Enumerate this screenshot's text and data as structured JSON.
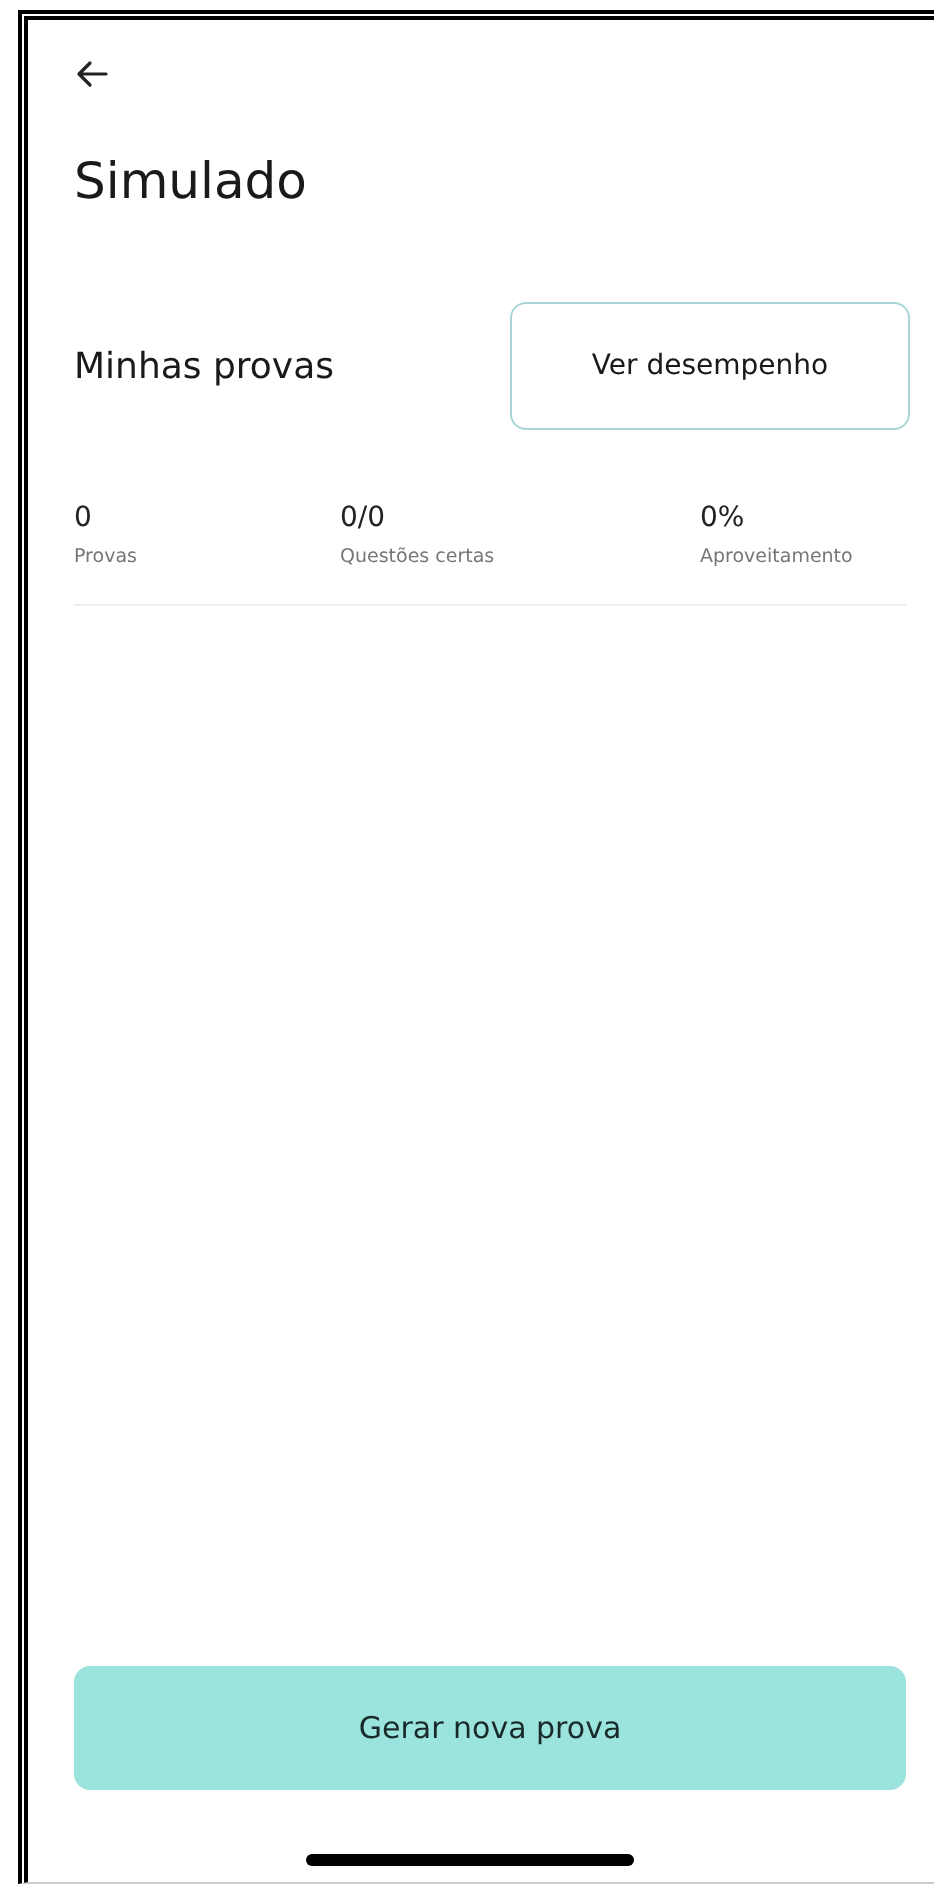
{
  "header": {
    "title": "Simulado"
  },
  "section": {
    "title": "Minhas provas",
    "button": "Ver desempenho"
  },
  "stats": [
    {
      "value": "0",
      "label": "Provas"
    },
    {
      "value": "0/0",
      "label": "Questões certas"
    },
    {
      "value": "0%",
      "label": "Aproveitamento"
    }
  ],
  "primary_button": "Gerar nova prova"
}
